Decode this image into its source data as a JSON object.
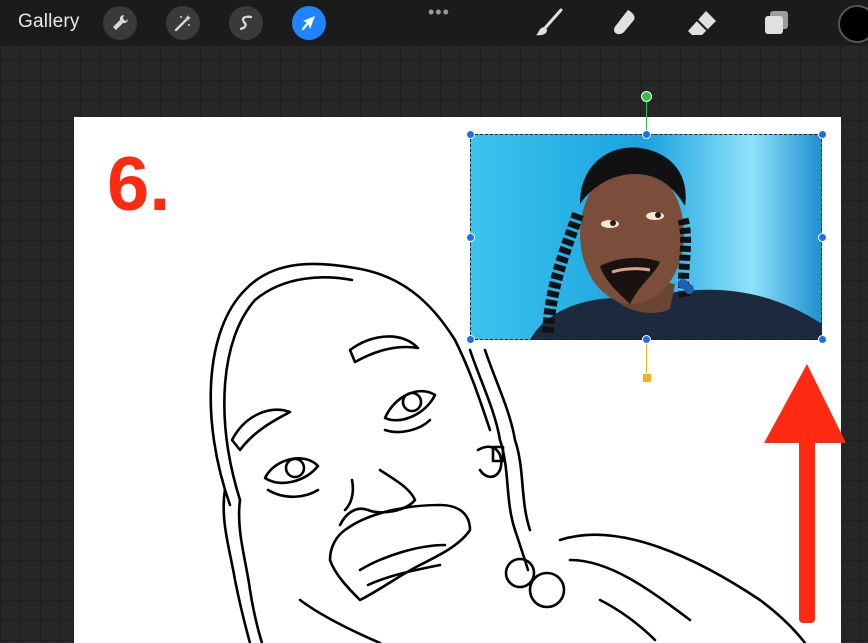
{
  "toolbar": {
    "gallery_label": "Gallery",
    "left_tools": [
      "wrench-icon",
      "magic-wand-icon",
      "selection-s-icon",
      "transform-arrow-icon"
    ],
    "active_tool": "transform-arrow-icon",
    "more_label": "•••",
    "right_tools": [
      "brush-icon",
      "smudge-icon",
      "eraser-icon",
      "layers-icon"
    ],
    "current_color": "#000000"
  },
  "canvas": {
    "step_label": "6.",
    "step_color": "#ff2a12",
    "accent_arrow_color": "#ff2a12"
  },
  "selection": {
    "rotation_handle_color": "#2ec14a",
    "warp_handle_color": "#f2b21b",
    "handle_color": "#1c6df0"
  }
}
